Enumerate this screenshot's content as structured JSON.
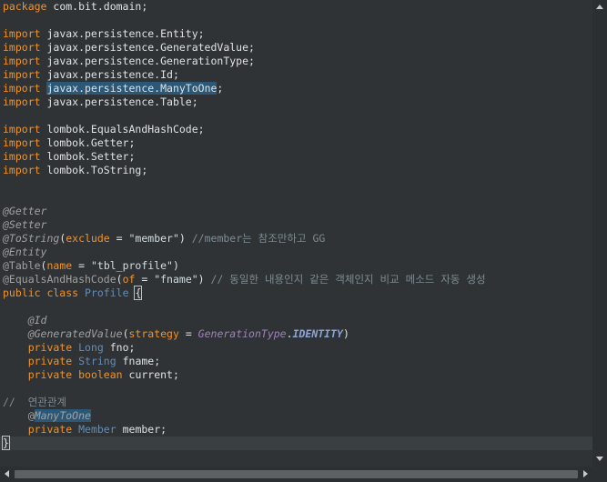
{
  "editor": {
    "lines": {
      "package": {
        "kw": "package",
        "name": " com.bit.domain;"
      },
      "imp1": {
        "kw": "import",
        "name": " javax.persistence.Entity;"
      },
      "imp2": {
        "kw": "import",
        "name": " javax.persistence.GeneratedValue;"
      },
      "imp3": {
        "kw": "import",
        "name": " javax.persistence.GenerationType;"
      },
      "imp4": {
        "kw": "import",
        "name": " javax.persistence.Id;"
      },
      "imp5": {
        "kw": "import",
        "sel": "javax.persistence.ManyToOne",
        "tail": ";"
      },
      "imp6": {
        "kw": "import",
        "name": " javax.persistence.Table;"
      },
      "imp7": {
        "kw": "import",
        "name": " lombok.EqualsAndHashCode;"
      },
      "imp8": {
        "kw": "import",
        "name": " lombok.Getter;"
      },
      "imp9": {
        "kw": "import",
        "name": " lombok.Setter;"
      },
      "imp10": {
        "kw": "import",
        "name": " lombok.ToString;"
      },
      "getter": "@Getter",
      "setter": "@Setter",
      "tostring": {
        "ann": "@ToString",
        "open": "(",
        "attr": "exclude",
        "eq": " = ",
        "val": "\"member\"",
        "close": ")",
        "comment": " //member는 참조만하고 GG"
      },
      "entity": "@Entity",
      "table": {
        "ann": "@Table",
        "open": "(",
        "attr": "name",
        "eq": " = ",
        "val": "\"tbl_profile\"",
        "close": ")"
      },
      "eqhash": {
        "ann": "@EqualsAndHashCode",
        "open": "(",
        "attr": "of",
        "eq": " = ",
        "val": "\"fname\"",
        "close": ")",
        "comment": " // 동일한 내용인지 같은 객체인지 비교 메소드 자동 생성"
      },
      "classdecl": {
        "kw": "public class",
        "name": "Profile",
        "brace": "{"
      },
      "id": "@Id",
      "genval": {
        "ann": "@GeneratedValue",
        "open": "(",
        "attr": "strategy",
        "eq": " = ",
        "enumType": "GenerationType",
        "dot": ".",
        "enumConst": "IDENTITY",
        "close": ")"
      },
      "fno": {
        "kw": "private",
        "type": "Long",
        "name": "fno;"
      },
      "fname": {
        "kw": "private",
        "type": "String",
        "name": "fname;"
      },
      "current": {
        "kw": "private",
        "type": "boolean",
        "name": "current;"
      },
      "relcomment": "//  연관관계",
      "manytoone": {
        "at": "@",
        "sel": "ManyToOne"
      },
      "member": {
        "kw": "private",
        "type": "Member",
        "name": "member;"
      },
      "closebrace": "}"
    }
  },
  "colors": {
    "background": "#2f3335",
    "keyword": "#f0922b",
    "type": "#678cb1",
    "annotation": "#a0a0a0",
    "string": "#ec7600",
    "comment": "#7d8c93",
    "selection": "#2c5877"
  }
}
